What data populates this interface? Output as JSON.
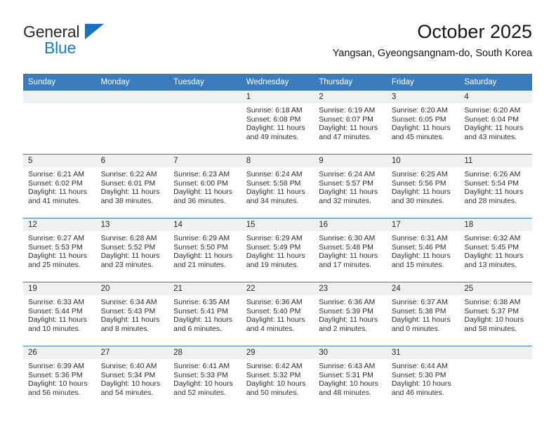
{
  "brand": {
    "name_top": "General",
    "name_bottom": "Blue",
    "triangle_icon": "triangle-icon",
    "accent_color": "#1a7bc4"
  },
  "header": {
    "title": "October 2025",
    "location": "Yangsan, Gyeongsangnam-do, South Korea"
  },
  "theme": {
    "header_blue": "#3c7cbc",
    "daynum_background": "#f0f0f0",
    "text_color": "#2e2e2e"
  },
  "weekday_headers": [
    "Sunday",
    "Monday",
    "Tuesday",
    "Wednesday",
    "Thursday",
    "Friday",
    "Saturday"
  ],
  "labels": {
    "sunrise_prefix": "Sunrise:",
    "sunset_prefix": "Sunset:",
    "daylight_prefix": "Daylight:"
  },
  "weeks": [
    [
      {
        "day": "",
        "empty": true,
        "sunrise": "",
        "sunset": "",
        "daylight_line1": "",
        "daylight_line2": ""
      },
      {
        "day": "",
        "empty": true,
        "sunrise": "",
        "sunset": "",
        "daylight_line1": "",
        "daylight_line2": ""
      },
      {
        "day": "",
        "empty": true,
        "sunrise": "",
        "sunset": "",
        "daylight_line1": "",
        "daylight_line2": ""
      },
      {
        "day": "1",
        "empty": false,
        "sunrise": "Sunrise: 6:18 AM",
        "sunset": "Sunset: 6:08 PM",
        "daylight_line1": "Daylight: 11 hours",
        "daylight_line2": "and 49 minutes."
      },
      {
        "day": "2",
        "empty": false,
        "sunrise": "Sunrise: 6:19 AM",
        "sunset": "Sunset: 6:07 PM",
        "daylight_line1": "Daylight: 11 hours",
        "daylight_line2": "and 47 minutes."
      },
      {
        "day": "3",
        "empty": false,
        "sunrise": "Sunrise: 6:20 AM",
        "sunset": "Sunset: 6:05 PM",
        "daylight_line1": "Daylight: 11 hours",
        "daylight_line2": "and 45 minutes."
      },
      {
        "day": "4",
        "empty": false,
        "sunrise": "Sunrise: 6:20 AM",
        "sunset": "Sunset: 6:04 PM",
        "daylight_line1": "Daylight: 11 hours",
        "daylight_line2": "and 43 minutes."
      }
    ],
    [
      {
        "day": "5",
        "empty": false,
        "sunrise": "Sunrise: 6:21 AM",
        "sunset": "Sunset: 6:02 PM",
        "daylight_line1": "Daylight: 11 hours",
        "daylight_line2": "and 41 minutes."
      },
      {
        "day": "6",
        "empty": false,
        "sunrise": "Sunrise: 6:22 AM",
        "sunset": "Sunset: 6:01 PM",
        "daylight_line1": "Daylight: 11 hours",
        "daylight_line2": "and 38 minutes."
      },
      {
        "day": "7",
        "empty": false,
        "sunrise": "Sunrise: 6:23 AM",
        "sunset": "Sunset: 6:00 PM",
        "daylight_line1": "Daylight: 11 hours",
        "daylight_line2": "and 36 minutes."
      },
      {
        "day": "8",
        "empty": false,
        "sunrise": "Sunrise: 6:24 AM",
        "sunset": "Sunset: 5:58 PM",
        "daylight_line1": "Daylight: 11 hours",
        "daylight_line2": "and 34 minutes."
      },
      {
        "day": "9",
        "empty": false,
        "sunrise": "Sunrise: 6:24 AM",
        "sunset": "Sunset: 5:57 PM",
        "daylight_line1": "Daylight: 11 hours",
        "daylight_line2": "and 32 minutes."
      },
      {
        "day": "10",
        "empty": false,
        "sunrise": "Sunrise: 6:25 AM",
        "sunset": "Sunset: 5:56 PM",
        "daylight_line1": "Daylight: 11 hours",
        "daylight_line2": "and 30 minutes."
      },
      {
        "day": "11",
        "empty": false,
        "sunrise": "Sunrise: 6:26 AM",
        "sunset": "Sunset: 5:54 PM",
        "daylight_line1": "Daylight: 11 hours",
        "daylight_line2": "and 28 minutes."
      }
    ],
    [
      {
        "day": "12",
        "empty": false,
        "sunrise": "Sunrise: 6:27 AM",
        "sunset": "Sunset: 5:53 PM",
        "daylight_line1": "Daylight: 11 hours",
        "daylight_line2": "and 25 minutes."
      },
      {
        "day": "13",
        "empty": false,
        "sunrise": "Sunrise: 6:28 AM",
        "sunset": "Sunset: 5:52 PM",
        "daylight_line1": "Daylight: 11 hours",
        "daylight_line2": "and 23 minutes."
      },
      {
        "day": "14",
        "empty": false,
        "sunrise": "Sunrise: 6:29 AM",
        "sunset": "Sunset: 5:50 PM",
        "daylight_line1": "Daylight: 11 hours",
        "daylight_line2": "and 21 minutes."
      },
      {
        "day": "15",
        "empty": false,
        "sunrise": "Sunrise: 6:29 AM",
        "sunset": "Sunset: 5:49 PM",
        "daylight_line1": "Daylight: 11 hours",
        "daylight_line2": "and 19 minutes."
      },
      {
        "day": "16",
        "empty": false,
        "sunrise": "Sunrise: 6:30 AM",
        "sunset": "Sunset: 5:48 PM",
        "daylight_line1": "Daylight: 11 hours",
        "daylight_line2": "and 17 minutes."
      },
      {
        "day": "17",
        "empty": false,
        "sunrise": "Sunrise: 6:31 AM",
        "sunset": "Sunset: 5:46 PM",
        "daylight_line1": "Daylight: 11 hours",
        "daylight_line2": "and 15 minutes."
      },
      {
        "day": "18",
        "empty": false,
        "sunrise": "Sunrise: 6:32 AM",
        "sunset": "Sunset: 5:45 PM",
        "daylight_line1": "Daylight: 11 hours",
        "daylight_line2": "and 13 minutes."
      }
    ],
    [
      {
        "day": "19",
        "empty": false,
        "sunrise": "Sunrise: 6:33 AM",
        "sunset": "Sunset: 5:44 PM",
        "daylight_line1": "Daylight: 11 hours",
        "daylight_line2": "and 10 minutes."
      },
      {
        "day": "20",
        "empty": false,
        "sunrise": "Sunrise: 6:34 AM",
        "sunset": "Sunset: 5:43 PM",
        "daylight_line1": "Daylight: 11 hours",
        "daylight_line2": "and 8 minutes."
      },
      {
        "day": "21",
        "empty": false,
        "sunrise": "Sunrise: 6:35 AM",
        "sunset": "Sunset: 5:41 PM",
        "daylight_line1": "Daylight: 11 hours",
        "daylight_line2": "and 6 minutes."
      },
      {
        "day": "22",
        "empty": false,
        "sunrise": "Sunrise: 6:36 AM",
        "sunset": "Sunset: 5:40 PM",
        "daylight_line1": "Daylight: 11 hours",
        "daylight_line2": "and 4 minutes."
      },
      {
        "day": "23",
        "empty": false,
        "sunrise": "Sunrise: 6:36 AM",
        "sunset": "Sunset: 5:39 PM",
        "daylight_line1": "Daylight: 11 hours",
        "daylight_line2": "and 2 minutes."
      },
      {
        "day": "24",
        "empty": false,
        "sunrise": "Sunrise: 6:37 AM",
        "sunset": "Sunset: 5:38 PM",
        "daylight_line1": "Daylight: 11 hours",
        "daylight_line2": "and 0 minutes."
      },
      {
        "day": "25",
        "empty": false,
        "sunrise": "Sunrise: 6:38 AM",
        "sunset": "Sunset: 5:37 PM",
        "daylight_line1": "Daylight: 10 hours",
        "daylight_line2": "and 58 minutes."
      }
    ],
    [
      {
        "day": "26",
        "empty": false,
        "sunrise": "Sunrise: 6:39 AM",
        "sunset": "Sunset: 5:36 PM",
        "daylight_line1": "Daylight: 10 hours",
        "daylight_line2": "and 56 minutes."
      },
      {
        "day": "27",
        "empty": false,
        "sunrise": "Sunrise: 6:40 AM",
        "sunset": "Sunset: 5:34 PM",
        "daylight_line1": "Daylight: 10 hours",
        "daylight_line2": "and 54 minutes."
      },
      {
        "day": "28",
        "empty": false,
        "sunrise": "Sunrise: 6:41 AM",
        "sunset": "Sunset: 5:33 PM",
        "daylight_line1": "Daylight: 10 hours",
        "daylight_line2": "and 52 minutes."
      },
      {
        "day": "29",
        "empty": false,
        "sunrise": "Sunrise: 6:42 AM",
        "sunset": "Sunset: 5:32 PM",
        "daylight_line1": "Daylight: 10 hours",
        "daylight_line2": "and 50 minutes."
      },
      {
        "day": "30",
        "empty": false,
        "sunrise": "Sunrise: 6:43 AM",
        "sunset": "Sunset: 5:31 PM",
        "daylight_line1": "Daylight: 10 hours",
        "daylight_line2": "and 48 minutes."
      },
      {
        "day": "31",
        "empty": false,
        "sunrise": "Sunrise: 6:44 AM",
        "sunset": "Sunset: 5:30 PM",
        "daylight_line1": "Daylight: 10 hours",
        "daylight_line2": "and 46 minutes."
      },
      {
        "day": "",
        "empty": true,
        "sunrise": "",
        "sunset": "",
        "daylight_line1": "",
        "daylight_line2": ""
      }
    ]
  ]
}
